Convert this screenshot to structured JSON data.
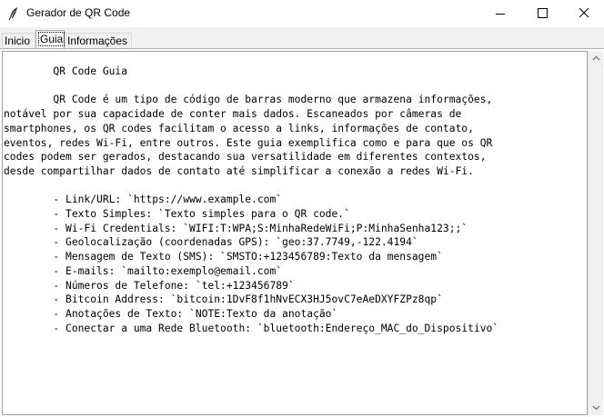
{
  "window": {
    "title": "Gerador de QR Code",
    "icon": "feather-icon",
    "controls": [
      "minimize-icon",
      "maximize-icon",
      "close-icon"
    ]
  },
  "tabs": [
    {
      "label": "Inicio",
      "active": false
    },
    {
      "label": "Guia",
      "active": true
    },
    {
      "label": "Informações",
      "active": false
    }
  ],
  "guide": {
    "text": "        QR Code Guia\n\n        QR Code é um tipo de código de barras moderno que armazena informações,\nnotável por sua capacidade de conter mais dados. Escaneados por câmeras de\nsmartphones, os QR codes facilitam o acesso a links, informações de contato,\neventos, redes Wi-Fi, entre outros. Este guia exemplifica como e para que os QR\ncodes podem ser gerados, destacando sua versatilidade em diferentes contextos,\ndesde compartilhar dados de contato até simplificar a conexão a redes Wi-Fi.\n\n        - Link/URL: `https://www.example.com`\n        - Texto Simples: `Texto simples para o QR code.`\n        - Wi-Fi Credentials: `WIFI:T:WPA;S:MinhaRedeWiFi;P:MinhaSenha123;;`\n        - Geolocalização (coordenadas GPS): `geo:37.7749,-122.4194`\n        - Mensagem de Texto (SMS): `SMSTO:+123456789:Texto da mensagem`\n        - E-mails: `mailto:exemplo@email.com`\n        - Números de Telefone: `tel:+123456789`\n        - Bitcoin Address: `bitcoin:1DvF8f1hNvECX3HJ5ovC7eAeDXYFZPz8qp`\n        - Anotações de Texto: `NOTE:Texto da anotação`\n        - Conectar a uma Rede Bluetooth: `bluetooth:Endereço_MAC_do_Dispositivo`"
  },
  "scrollbar": {
    "up": "scroll-up-arrow-icon",
    "down": "scroll-down-arrow-icon"
  }
}
